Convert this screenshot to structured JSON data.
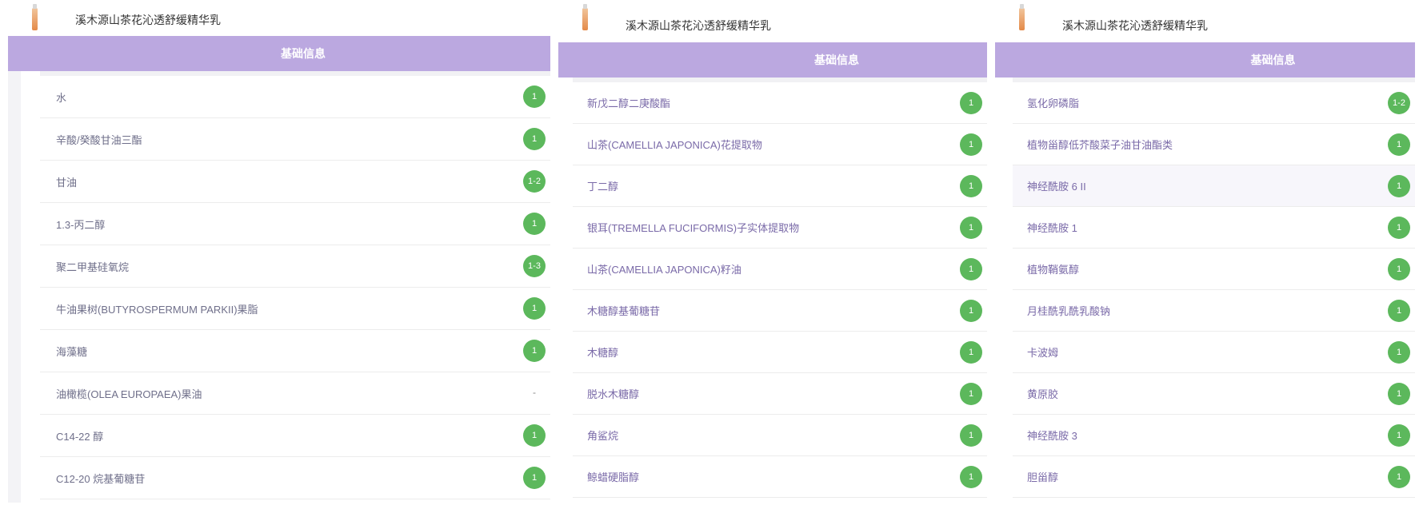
{
  "panels": [
    {
      "product_name": "溪木源山茶花沁透舒缓精华乳",
      "header": "基础信息",
      "rows": [
        {
          "name": "水",
          "rating": "1"
        },
        {
          "name": "辛酸/癸酸甘油三酯",
          "rating": "1"
        },
        {
          "name": "甘油",
          "rating": "1-2"
        },
        {
          "name": "1.3-丙二醇",
          "rating": "1"
        },
        {
          "name": "聚二甲基硅氧烷",
          "rating": "1-3"
        },
        {
          "name": "牛油果树(BUTYROSPERMUM PARKII)果脂",
          "rating": "1"
        },
        {
          "name": "海藻糖",
          "rating": "1"
        },
        {
          "name": "油橄榄(OLEA EUROPAEA)果油",
          "rating": "-"
        },
        {
          "name": "C14-22 醇",
          "rating": "1"
        },
        {
          "name": "C12-20 烷基葡糖苷",
          "rating": "1"
        }
      ]
    },
    {
      "product_name": "溪木源山茶花沁透舒缓精华乳",
      "header": "基础信息",
      "rows": [
        {
          "name": "新戊二醇二庚酸酯",
          "rating": "1"
        },
        {
          "name": "山茶(CAMELLIA JAPONICA)花提取物",
          "rating": "1"
        },
        {
          "name": "丁二醇",
          "rating": "1"
        },
        {
          "name": "银耳(TREMELLA FUCIFORMIS)子实体提取物",
          "rating": "1"
        },
        {
          "name": "山茶(CAMELLIA JAPONICA)籽油",
          "rating": "1"
        },
        {
          "name": "木糖醇基葡糖苷",
          "rating": "1"
        },
        {
          "name": "木糖醇",
          "rating": "1"
        },
        {
          "name": "脱水木糖醇",
          "rating": "1"
        },
        {
          "name": "角鲨烷",
          "rating": "1"
        },
        {
          "name": "鲸蜡硬脂醇",
          "rating": "1"
        }
      ]
    },
    {
      "product_name": "溪木源山茶花沁透舒缓精华乳",
      "header": "基础信息",
      "rows": [
        {
          "name": "氢化卵磷脂",
          "rating": "1-2"
        },
        {
          "name": "植物甾醇低芥酸菜子油甘油酯类",
          "rating": "1"
        },
        {
          "name": "神经酰胺 6 II",
          "rating": "1"
        },
        {
          "name": "神经酰胺 1",
          "rating": "1"
        },
        {
          "name": "植物鞘氨醇",
          "rating": "1"
        },
        {
          "name": "月桂酰乳酰乳酸钠",
          "rating": "1"
        },
        {
          "name": "卡波姆",
          "rating": "1"
        },
        {
          "name": "黄原胶",
          "rating": "1"
        },
        {
          "name": "神经酰胺 3",
          "rating": "1"
        },
        {
          "name": "胆甾醇",
          "rating": "1"
        }
      ]
    }
  ],
  "colors": {
    "header": "#bba8e0",
    "badge": "#5cb85c",
    "label": "#7a6aa8"
  }
}
